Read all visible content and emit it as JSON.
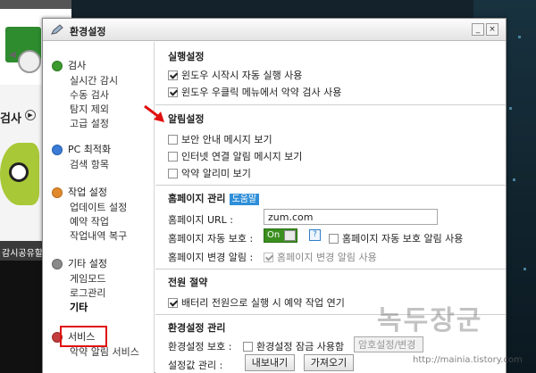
{
  "background": {
    "scan_label": "검사",
    "band_text": "감시공유할"
  },
  "dialog": {
    "title": "환경설정",
    "window_buttons": {
      "minimize": "_",
      "close": "×"
    }
  },
  "sidebar": {
    "groups": [
      {
        "label": "검사",
        "items": [
          "실시간 감시",
          "수동 검사",
          "탐지 제외",
          "고급 설정"
        ]
      },
      {
        "label": "PC 최적화",
        "items": [
          "검색 항목"
        ]
      },
      {
        "label": "작업 설정",
        "items": [
          "업데이트 설정",
          "예약 작업",
          "작업내역 복구"
        ]
      },
      {
        "label": "기타 설정",
        "items": [
          "게임모드",
          "로그관리",
          "기타"
        ]
      },
      {
        "label": "서비스",
        "items": [
          "악약 알림 서비스"
        ]
      }
    ],
    "active_item": "기타"
  },
  "content": {
    "run_settings": {
      "title": "실행설정",
      "options": [
        {
          "label": "윈도우 시작시 자동 실행 사용",
          "checked": true
        },
        {
          "label": "윈도우 우클릭 메뉴에서 악약 검사 사용",
          "checked": true
        }
      ]
    },
    "alarm_settings": {
      "title": "알림설정",
      "options": [
        {
          "label": "보안 안내 메시지 보기",
          "checked": false
        },
        {
          "label": "인터넷 연결 알림 메시지 보기",
          "checked": false
        },
        {
          "label": "악약 알리미 보기",
          "checked": false
        }
      ]
    },
    "homepage": {
      "title": "홈페이지 관리",
      "help_label": "도움말",
      "url_label": "홈페이지 URL :",
      "url_value": "zum.com",
      "auto_protect_label": "홈페이지 자동 보호 :",
      "toggle_label": "On",
      "help_icon": "?",
      "auto_protect_alarm_label": "홈페이지 자동 보호 알림 사용",
      "auto_protect_alarm_checked": false,
      "change_alarm_label": "홈페이지 변경 알림 :",
      "change_alarm_option": "홈페이지 변경 알림 사용",
      "change_alarm_checked": true
    },
    "power": {
      "title": "전원 절약",
      "option": "배터리 전원으로 실행 시 예약 작업 연기",
      "checked": true
    },
    "env_manage": {
      "title": "환경설정 관리",
      "protect_label": "환경설정 보호 :",
      "lock_option": "환경설정 잠금 사용함",
      "lock_checked": false,
      "password_placeholder": "암호설정/변경",
      "value_manage_label": "설정값 관리 :",
      "export_button": "내보내기",
      "import_button": "가져오기"
    }
  },
  "watermark": {
    "text": "녹두장군",
    "url": "http://mainia.tistory.com"
  },
  "colors": {
    "annotation_red": "#e01010",
    "toggle_green": "#3b8f1f",
    "help_blue": "#2f8fd8"
  }
}
